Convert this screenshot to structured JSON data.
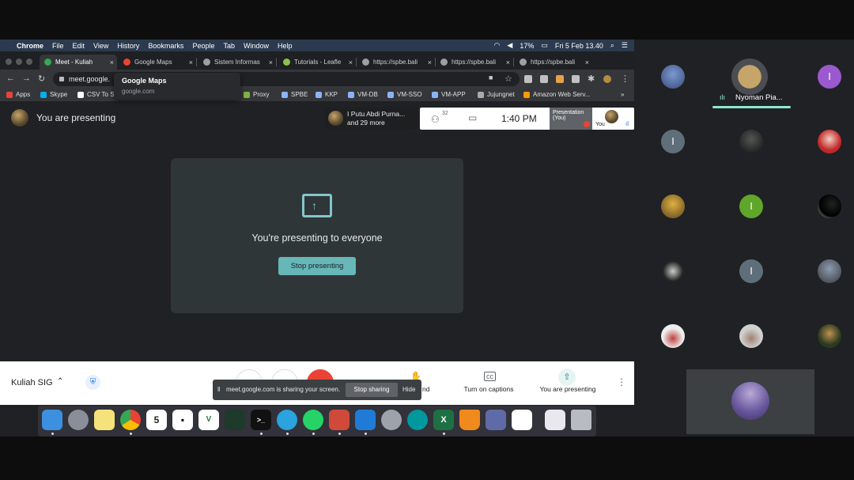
{
  "menubar": {
    "app": "Chrome",
    "items": [
      "File",
      "Edit",
      "View",
      "History",
      "Bookmarks",
      "People",
      "Tab",
      "Window",
      "Help"
    ],
    "battery": "17%",
    "datetime": "Fri 5 Feb 13.40"
  },
  "tabs": [
    {
      "label": "Meet - Kuliah"
    },
    {
      "label": "Google Maps"
    },
    {
      "label": "Sistem Informas"
    },
    {
      "label": "Tutorials - Leafle"
    },
    {
      "label": "https://spbe.bali"
    },
    {
      "label": "https://spbe.bali"
    },
    {
      "label": "https://spbe.bali"
    }
  ],
  "tooltip": {
    "title": "Google Maps",
    "url": "google.com"
  },
  "omnibox": {
    "url": "meet.google."
  },
  "bookmarks": [
    "Apps",
    "Skype",
    "CSV To S",
    "Proxy",
    "SPBE",
    "KKP",
    "VM-DB",
    "VM-SSO",
    "VM-APP",
    "Jujungnet",
    "Amazon Web Serv..."
  ],
  "meet": {
    "presenting_label": "You are presenting",
    "participants_chip": {
      "line1": "I Putu Abdi Purna...",
      "line2": "and 29 more"
    },
    "people_count": "32",
    "clock": "1:40 PM",
    "presentation_tile": {
      "line1": "Presentation",
      "line2": "(You)"
    },
    "self_label": "You",
    "card_message": "You're presenting to everyone",
    "stop_button": "Stop presenting",
    "meeting_name": "Kuliah SIG",
    "captions_label": "Turn on captions",
    "present_label": "You are presenting",
    "hand_label_fragment": "nd"
  },
  "share_bar": {
    "message": "meet.google.com is sharing your screen.",
    "stop": "Stop sharing",
    "hide": "Hide"
  },
  "gallery": {
    "speaker_name": "Nyoman Pia...",
    "initial": "I",
    "colors": {
      "purple": "#9b59d0",
      "green": "#5fa62a",
      "grey": "#5f6f7a",
      "speaker_bar": "#8ee8d4"
    }
  },
  "dock": [
    "Finder",
    "Launchpad",
    "Notes",
    "Chrome",
    "Calendar",
    "Notion",
    "VS",
    "Activity",
    "Terminal",
    "Telegram",
    "WhatsApp",
    "Outline",
    "VS Code",
    "Settings",
    "Arduino",
    "Excel",
    "VLC",
    "Mongo",
    "Sketch",
    "Files",
    "Trash"
  ],
  "calendar_day": "5"
}
